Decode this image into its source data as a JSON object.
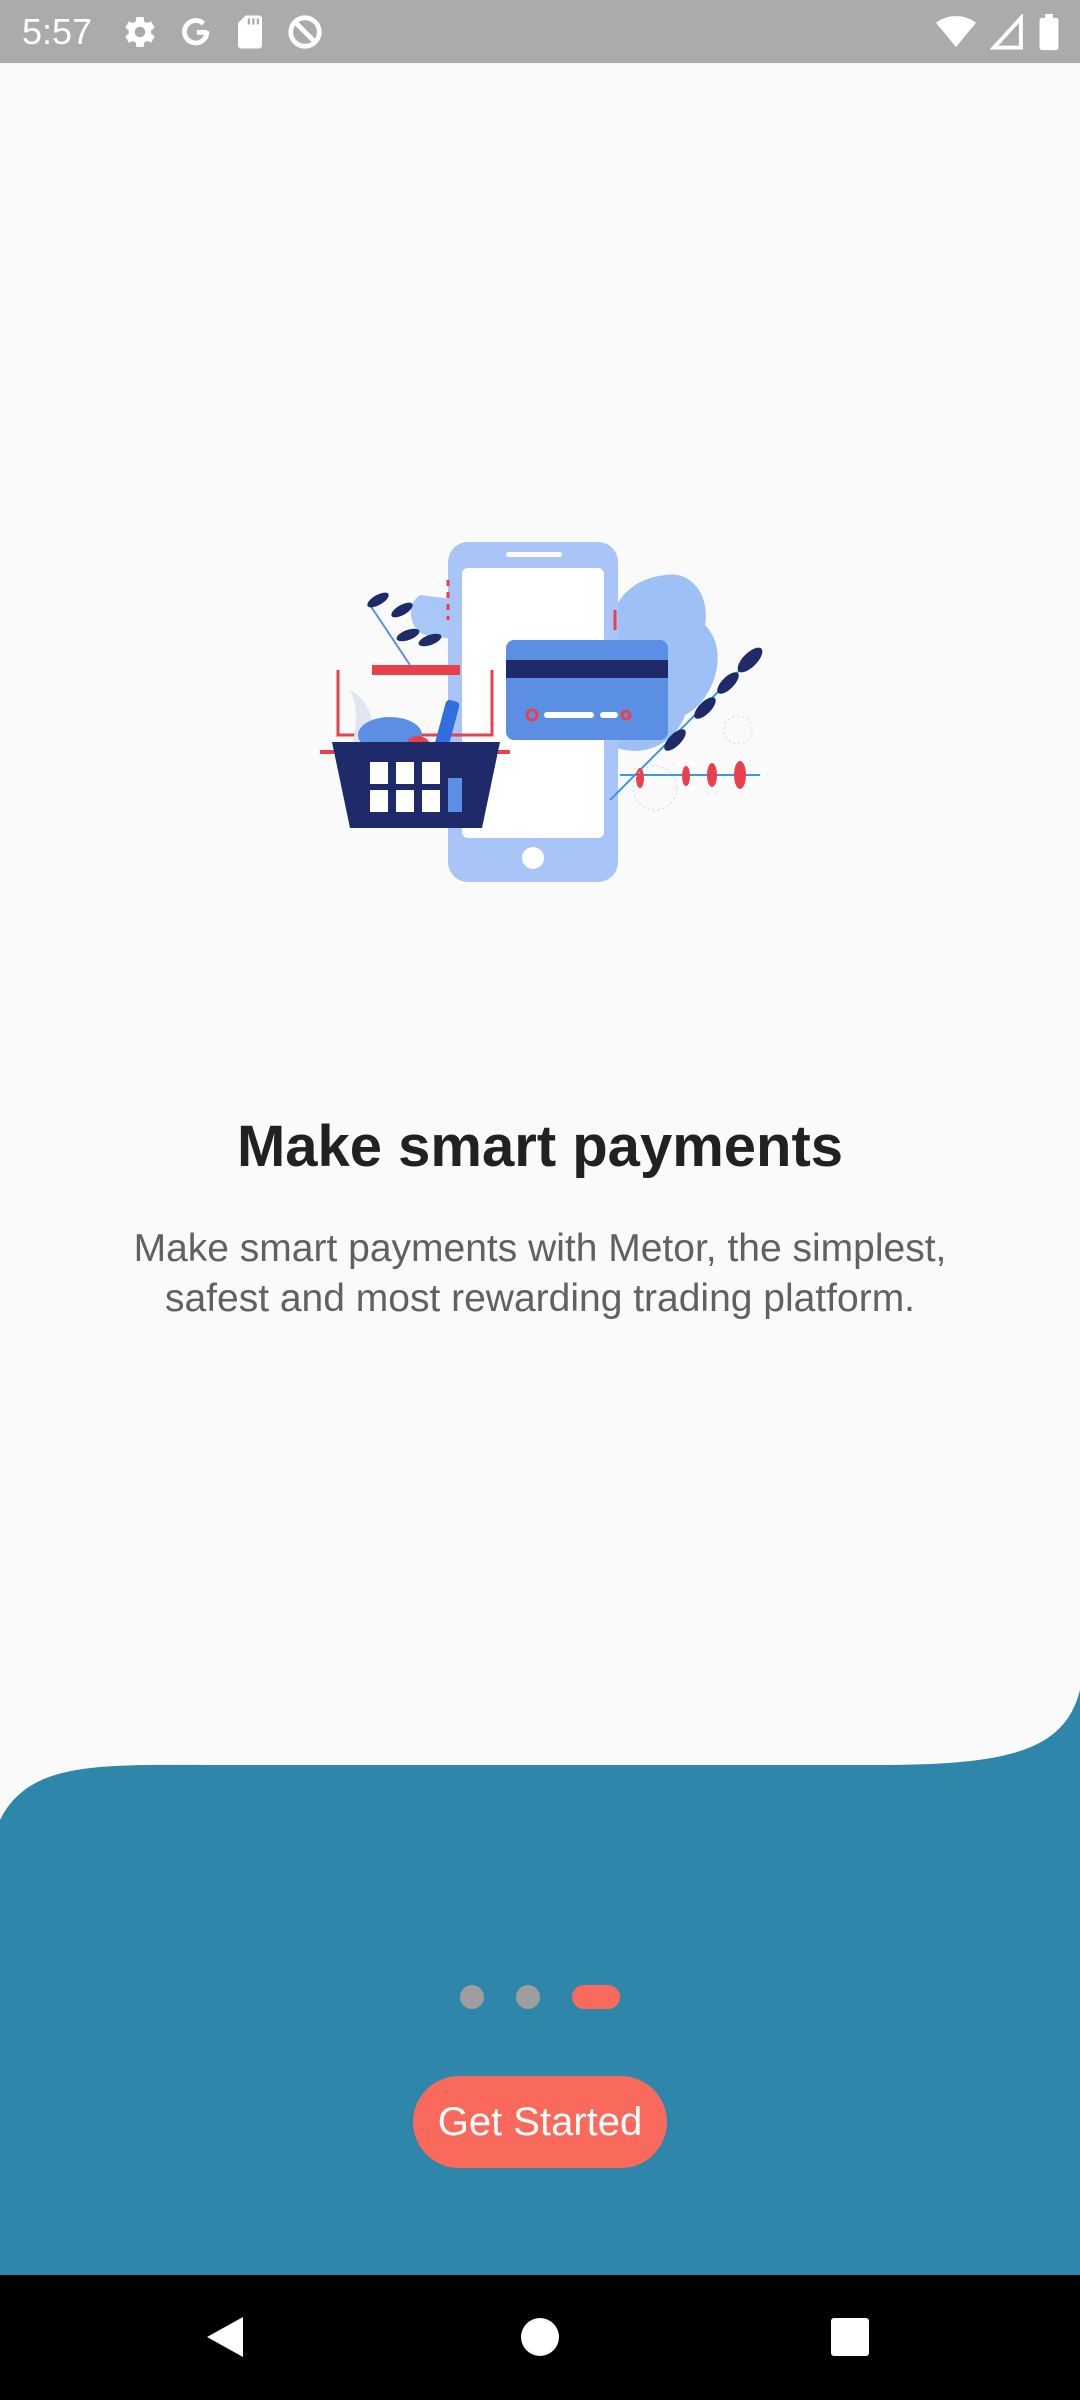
{
  "status_bar": {
    "time": "5:57",
    "left_icons": [
      "gear-icon",
      "google-icon",
      "sd-card-icon",
      "data-saver-icon"
    ],
    "right_icons": [
      "wifi-icon",
      "cell-signal-icon",
      "battery-icon"
    ]
  },
  "onboarding": {
    "illustration": "payment-illustration",
    "title": "Make smart payments",
    "description": "Make smart payments with Metor, the simplest, safest and most rewarding trading platform.",
    "page_indicator": {
      "total": 3,
      "current": 3
    },
    "cta_label": "Get Started"
  },
  "navigation_bar": {
    "buttons": [
      "back",
      "home",
      "recents"
    ]
  },
  "colors": {
    "accent": "#fa6a5c",
    "wave": "#2e87aa",
    "background": "#fafafa",
    "status_bar": "#ababab",
    "title": "#212121",
    "body": "#616161",
    "dot_inactive": "#9e9e9e"
  }
}
